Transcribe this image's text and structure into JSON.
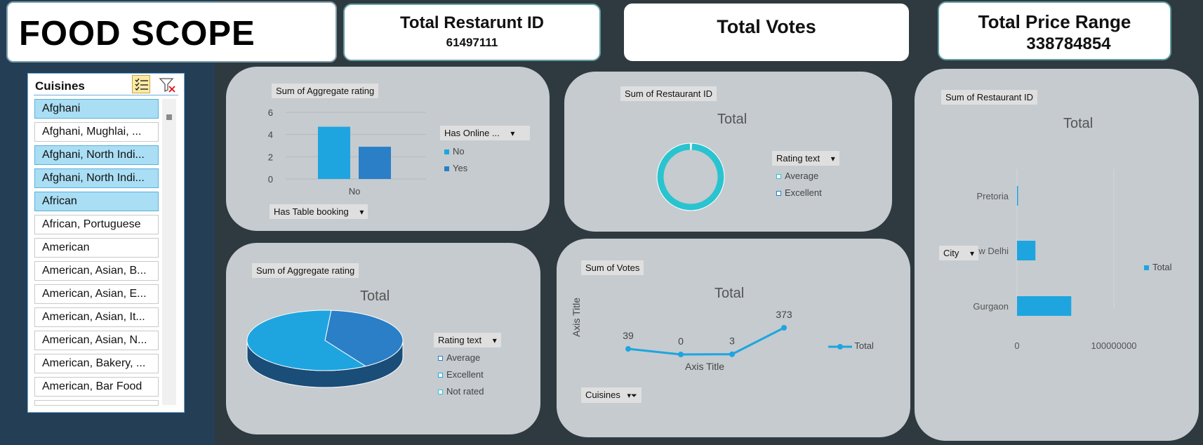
{
  "header": {
    "title": "FOOD SCOPE",
    "cards": [
      {
        "title": "Total Restarunt ID",
        "value": "61497111"
      },
      {
        "title": "Total Votes",
        "value": ""
      },
      {
        "title": "Total Price Range",
        "value": "338784854"
      }
    ]
  },
  "slicer": {
    "title": "Cuisines",
    "items": [
      {
        "label": "Afghani",
        "selected": true
      },
      {
        "label": "Afghani, Mughlai, ...",
        "selected": false
      },
      {
        "label": "Afghani, North Indi...",
        "selected": true
      },
      {
        "label": "Afghani, North Indi...",
        "selected": true
      },
      {
        "label": "African",
        "selected": true
      },
      {
        "label": "African, Portuguese",
        "selected": false
      },
      {
        "label": "American",
        "selected": false
      },
      {
        "label": "American, Asian, B...",
        "selected": false
      },
      {
        "label": "American, Asian, E...",
        "selected": false
      },
      {
        "label": "American, Asian, It...",
        "selected": false
      },
      {
        "label": "American, Asian, N...",
        "selected": false
      },
      {
        "label": "American, Bakery, ...",
        "selected": false
      },
      {
        "label": "American, Bar Food",
        "selected": false
      }
    ]
  },
  "bar_panel": {
    "value_button": "Sum of Aggregate rating",
    "legend_button": "Has Online ...",
    "axis_button": "Has Table booking"
  },
  "donut_panel": {
    "value_button": "Sum of Restaurant ID",
    "title": "Total",
    "legend_button": "Rating text"
  },
  "pie_panel": {
    "value_button": "Sum of Aggregate rating",
    "title": "Total",
    "legend_button": "Rating text"
  },
  "line_panel": {
    "value_button": "Sum of Votes",
    "title": "Total",
    "axis_button": "Cuisines",
    "xlabel": "Axis Title",
    "ylabel": "Axis Title"
  },
  "hbar_panel": {
    "value_button": "Sum of Restaurant ID",
    "title": "Total",
    "axis_button": "City"
  },
  "colors": {
    "accent": "#1ea5e0",
    "accent_dark": "#2a7fc7",
    "donut": "#29c4cf",
    "panel": "#c5cbcf"
  },
  "chart_data": [
    {
      "type": "bar",
      "categories": [
        "No"
      ],
      "series": [
        {
          "name": "No",
          "values": [
            4.7
          ]
        },
        {
          "name": "Yes",
          "values": [
            2.9
          ]
        }
      ],
      "ylim": [
        0,
        6
      ],
      "yticks": [
        "0",
        "2",
        "4",
        "6"
      ],
      "legend": "right"
    },
    {
      "type": "pie",
      "variant": "donut",
      "labels": [
        "Average",
        "Excellent"
      ],
      "values": [
        99,
        1
      ],
      "legend": "right"
    },
    {
      "type": "pie",
      "variant": "3d",
      "labels": [
        "Average",
        "Excellent",
        "Not rated"
      ],
      "values": [
        40,
        60,
        0
      ],
      "legend": "right"
    },
    {
      "type": "line",
      "series": [
        {
          "name": "Total",
          "values": [
            39,
            0,
            3,
            373
          ]
        }
      ],
      "data_labels": [
        "39",
        "0",
        "3",
        "373"
      ],
      "legend": "right"
    },
    {
      "type": "bar",
      "orientation": "horizontal",
      "categories": [
        "Pretoria",
        "New Delhi",
        "Gurgaon"
      ],
      "category_labels": [
        "Pretoria",
        "ew Delhi",
        "Gurgaon"
      ],
      "series": [
        {
          "name": "Total",
          "values": [
            1000000,
            19000000,
            56000000
          ]
        }
      ],
      "xlim": [
        0,
        100000000
      ],
      "xticks": [
        "0",
        "100000000"
      ],
      "legend": "right"
    }
  ]
}
